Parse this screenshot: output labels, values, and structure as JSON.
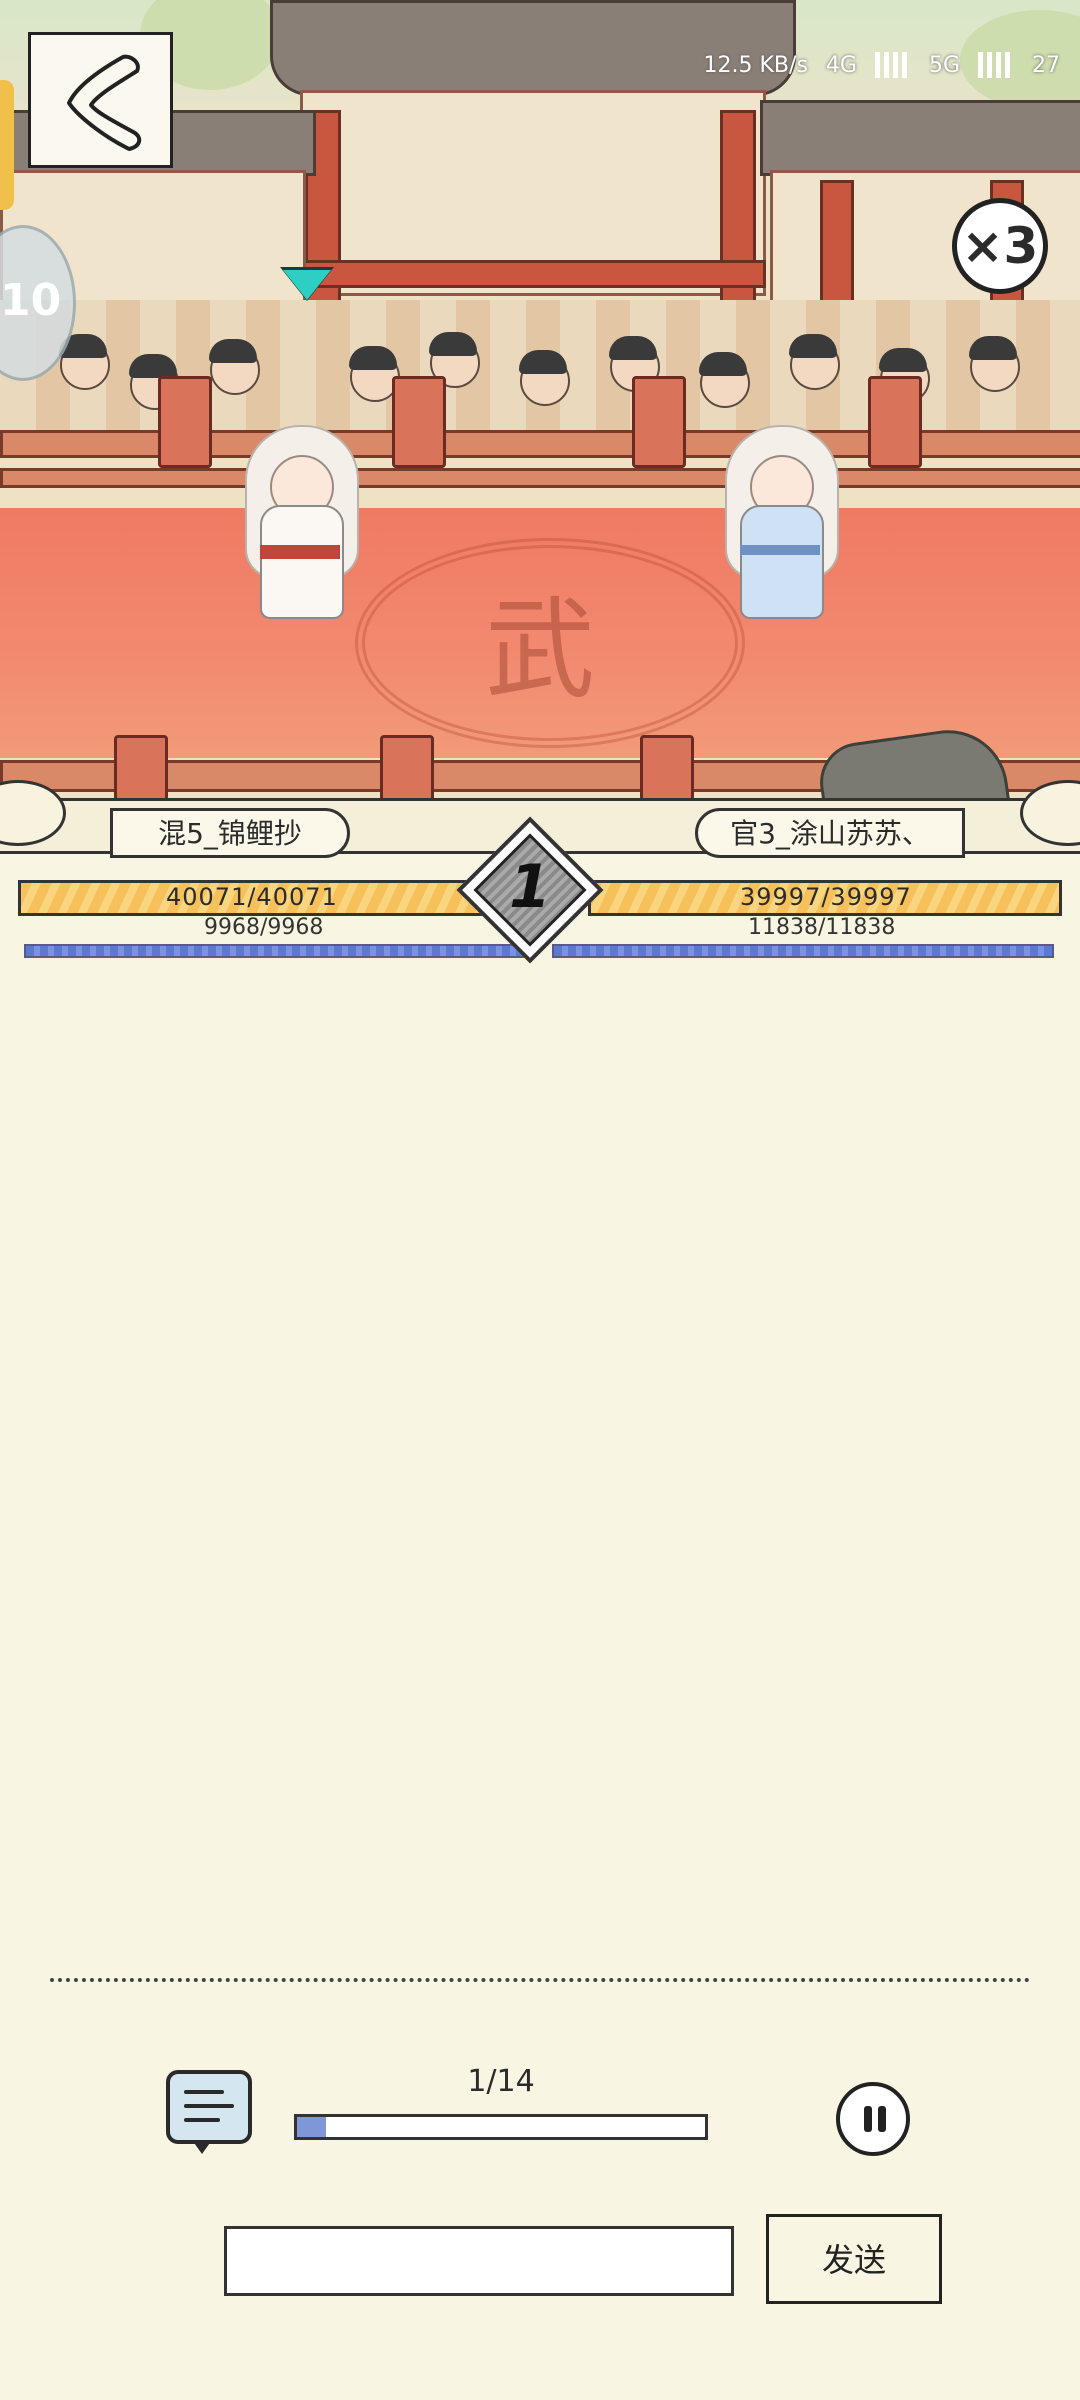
{
  "status_bar": {
    "speed": "12.5 KB/s",
    "network_1": "4G",
    "network_2": "5G",
    "battery": "27"
  },
  "arena": {
    "floor_glyph": "武",
    "speed_multiplier": "×3",
    "side_tab_label": "10"
  },
  "player_left": {
    "name": "混5_锦鲤抄",
    "hp": "40071/40071",
    "mp": "9968/9968"
  },
  "player_right": {
    "name": "官3_涂山苏苏、",
    "hp": "39997/39997",
    "mp": "11838/11838"
  },
  "round": "1",
  "playback": {
    "progress_label": "1/14",
    "progress": 0.0714
  },
  "chat": {
    "input_value": "",
    "send_label": "发送"
  },
  "icons": [
    "back-icon",
    "chat-icon",
    "pause-icon",
    "speed-icon",
    "turn-indicator-icon"
  ],
  "colors": {
    "hp": "#f6c05a",
    "mp": "#5a79d4",
    "floor": "#ef7a62",
    "background": "#f8f6e2"
  }
}
